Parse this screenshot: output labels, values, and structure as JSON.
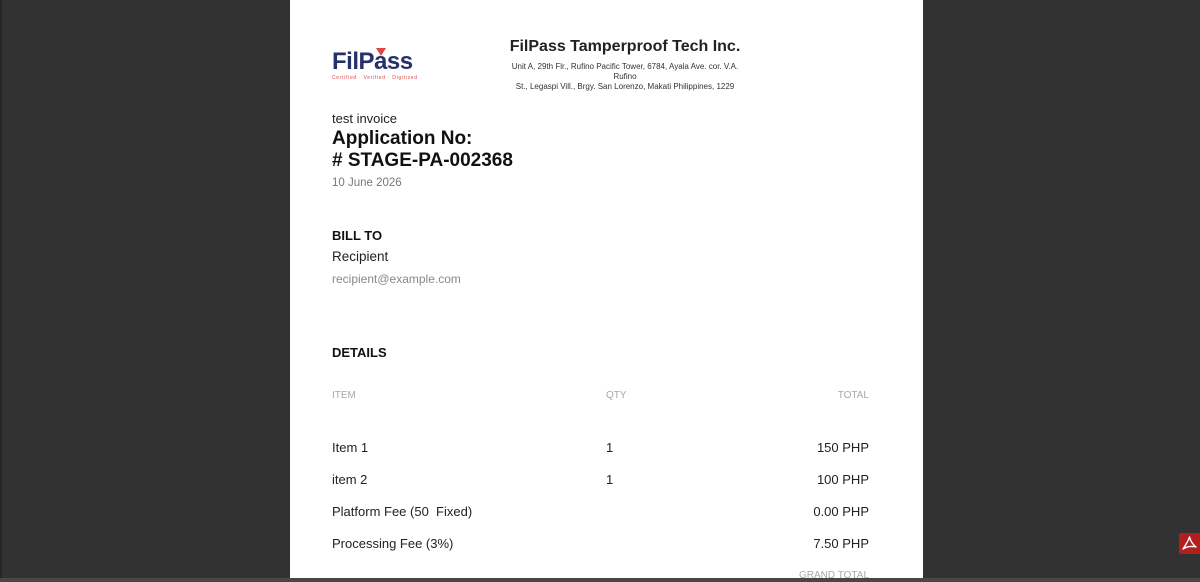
{
  "logo": {
    "word": "FilPass",
    "tagline": "Certified · Verified · Digitized",
    "accent_color": "#e04646",
    "brand_color": "#25316a"
  },
  "header": {
    "company": "FilPass Tamperproof Tech Inc.",
    "address_line1": "Unit A, 29th Flr., Rufino Pacific Tower, 6784, Ayala Ave. cor. V.A. Rufino",
    "address_line2": "St., Legaspi Vill., Brgy. San Lorenzo, Makati Philippines, 1229"
  },
  "invoice": {
    "description": "test invoice",
    "app_no_label": "Application No:",
    "app_no_value": "# STAGE-PA-002368",
    "date": "10 June 2026"
  },
  "bill_to": {
    "heading": "BILL TO",
    "name": "Recipient",
    "email": "recipient@example.com"
  },
  "details": {
    "heading": "DETAILS",
    "columns": {
      "item": "ITEM",
      "qty": "QTY",
      "total": "TOTAL"
    },
    "rows": [
      {
        "item": "Item 1",
        "qty": "1",
        "total": "150 PHP"
      },
      {
        "item": "item 2",
        "qty": "1",
        "total": "100 PHP"
      },
      {
        "item": "Platform Fee (50  Fixed)",
        "qty": "",
        "total": "0.00 PHP"
      },
      {
        "item": "Processing Fee (3%)",
        "qty": "",
        "total": "7.50 PHP"
      }
    ],
    "grand_total_label": "GRAND TOTAL"
  },
  "viewer": {
    "pdf_icon": "pdf-icon"
  }
}
